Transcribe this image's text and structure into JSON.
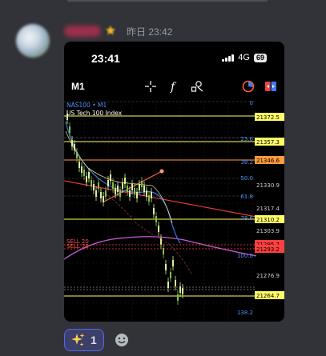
{
  "message": {
    "timestamp": "昨日 23:42"
  },
  "phone": {
    "time": "23:41",
    "network": "4G",
    "battery": "69"
  },
  "chart": {
    "timeframe": "M1",
    "symbol": "NAS100 • M1",
    "name": "US Tech 100 Index",
    "right_labels": [
      "0",
      "21372.5",
      "21357.3",
      "23.6",
      "21346.6",
      "38.2",
      "21330.9",
      "50.0",
      "61.8",
      "21317.4",
      "21310.2",
      "78.6",
      "21303.9",
      "21295.7",
      "21293.2",
      "100.0",
      "21276.9",
      "21264.7",
      "138.2"
    ],
    "order_labels": [
      "SELL 20",
      "SELL 20"
    ],
    "fib_levels": [
      "0",
      "23.6",
      "38.2",
      "50.0",
      "61.8",
      "78.6",
      "100.0",
      "138.2"
    ]
  },
  "reactions": [
    {
      "emoji": "sparkles-icon",
      "count": "1"
    }
  ],
  "colors": {
    "accent": "#5865f2",
    "price_highlight": "#ffff66",
    "sell_line": "#ff4040"
  }
}
